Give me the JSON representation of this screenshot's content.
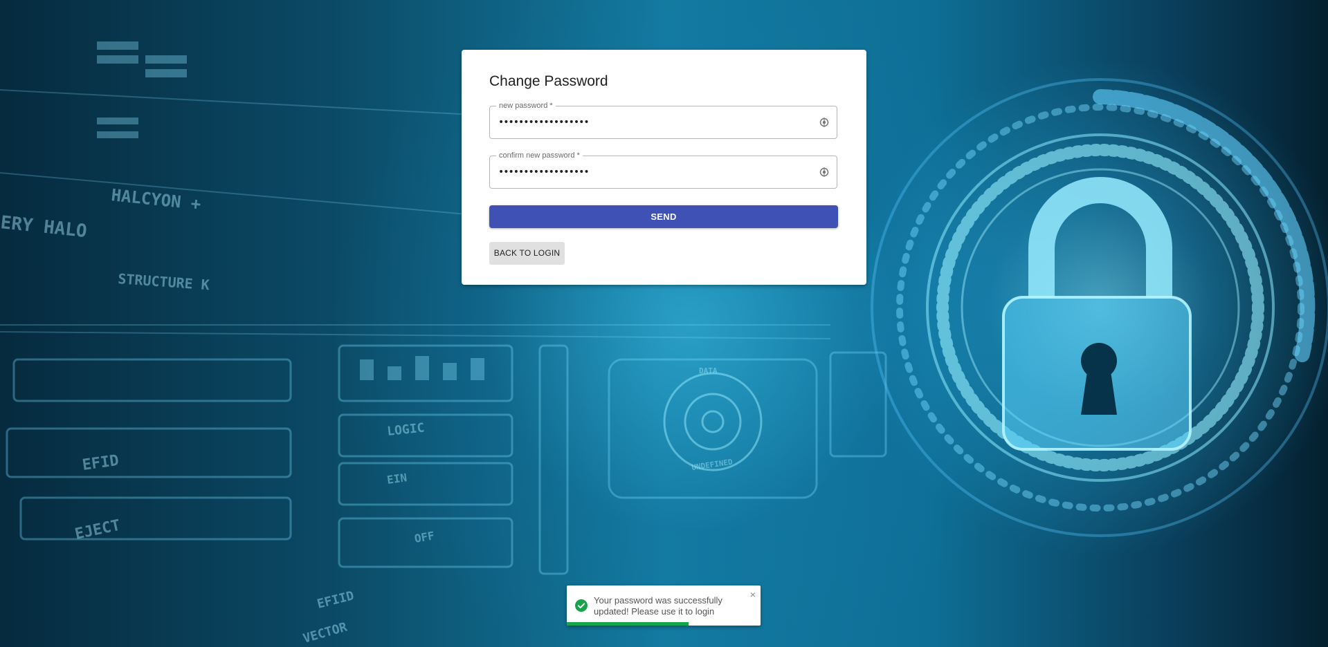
{
  "page": {
    "title": "Change Password"
  },
  "form": {
    "new_password": {
      "label": "new password *",
      "value": "••••••••••••••••••",
      "icon": "eye-icon"
    },
    "confirm_password": {
      "label": "confirm new password *",
      "value": "••••••••••••••••••",
      "icon": "eye-icon"
    },
    "send_label": "SEND",
    "back_label": "BACK TO LOGIN"
  },
  "toast": {
    "message": "Your password was successfully updated! Please use it to login",
    "icon": "check-circle-icon",
    "close_icon": "close-icon",
    "close_glyph": "×",
    "progress": 0.63
  },
  "colors": {
    "primary": "#3f51b5",
    "success": "#17a34a"
  },
  "background": {
    "texts": [
      "HALCYON +",
      "ERY HALO",
      "STRUCTURE K",
      "LOGIC",
      "EFID",
      "EJECT",
      "EIN",
      "OFF",
      "EFIID",
      "VECTOR",
      "DATA",
      "UNDEFINED"
    ]
  }
}
